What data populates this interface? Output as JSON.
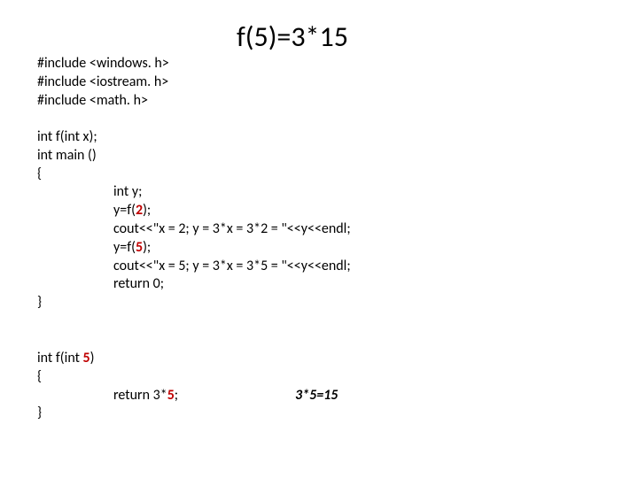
{
  "title": "f(5)=3*15",
  "includes": {
    "line1": "#include <windows. h>",
    "line2": "#include <iostream. h>",
    "line3": "#include <math. h>"
  },
  "main": {
    "decl": "int f(int x);",
    "mainDecl": "int main ()",
    "openBrace": "{",
    "line1": "int y;",
    "line2a": "y=f(",
    "line2b": "2",
    "line2c": ");",
    "line3": "cout<<\"x = 2;  y = 3*x = 3*2 = \"<<y<<endl;",
    "line4a": "y=f(",
    "line4b": "5",
    "line4c": ");",
    "line5": "cout<<\"x = 5;  y = 3*x = 3*5 = \"<<y<<endl;",
    "line6": "return 0;",
    "closeBrace": "}"
  },
  "func": {
    "declA": "int f(int ",
    "declB": "5",
    "declC": ")",
    "openBrace": "{",
    "retA": "return 3*",
    "retB": "5",
    "retC": ";",
    "closeBrace": "}"
  },
  "annotation": "3*5=15"
}
